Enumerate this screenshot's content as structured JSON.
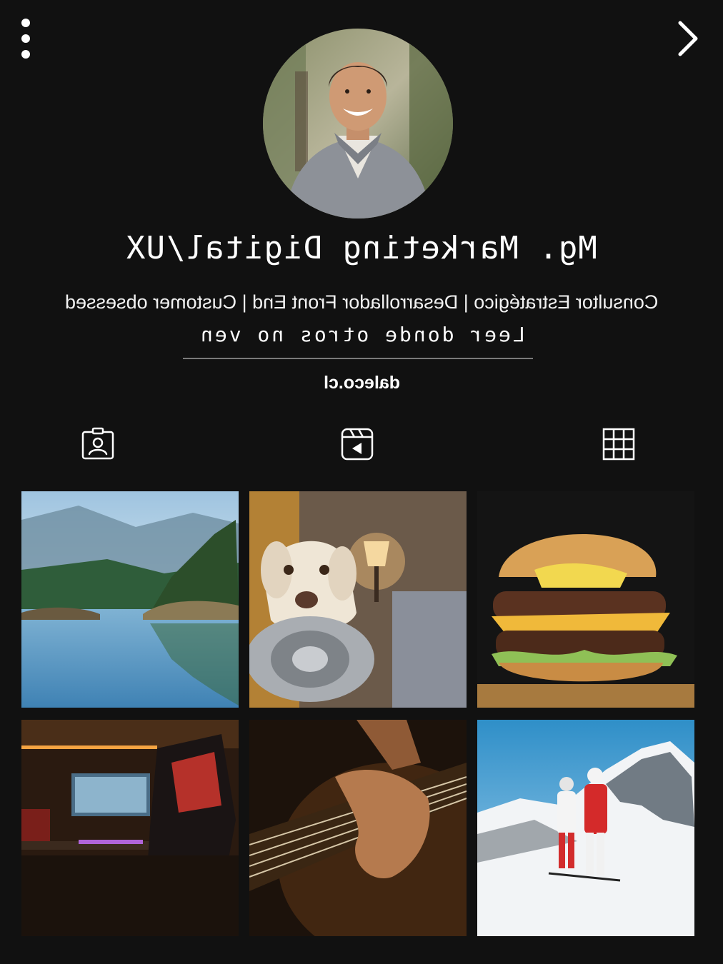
{
  "header": {
    "menu_icon": "vertical-ellipsis-icon",
    "next_icon": "chevron-right-icon"
  },
  "profile": {
    "avatar_alt": "profile photo",
    "title": "Mg. Marketing Digital/UX",
    "bio": "Consultor Estratégico | Desarrollador Front End | Customer obsessed",
    "tagline": "Leer donde otros no ven",
    "website": "daleco.cl"
  },
  "tabs": [
    {
      "id": "tagged",
      "icon": "person-badge-icon"
    },
    {
      "id": "reels",
      "icon": "reels-clapper-icon"
    },
    {
      "id": "grid",
      "icon": "grid-icon"
    }
  ],
  "posts": [
    {
      "subject": "lake with forested islands"
    },
    {
      "subject": "dog holding metal bowl"
    },
    {
      "subject": "double cheeseburger"
    },
    {
      "subject": "gaming setup"
    },
    {
      "subject": "hand playing guitar"
    },
    {
      "subject": "skiers on snowy mountain"
    }
  ],
  "colors": {
    "background": "#111111",
    "text": "#ffffff",
    "divider": "#7a7a7a"
  }
}
